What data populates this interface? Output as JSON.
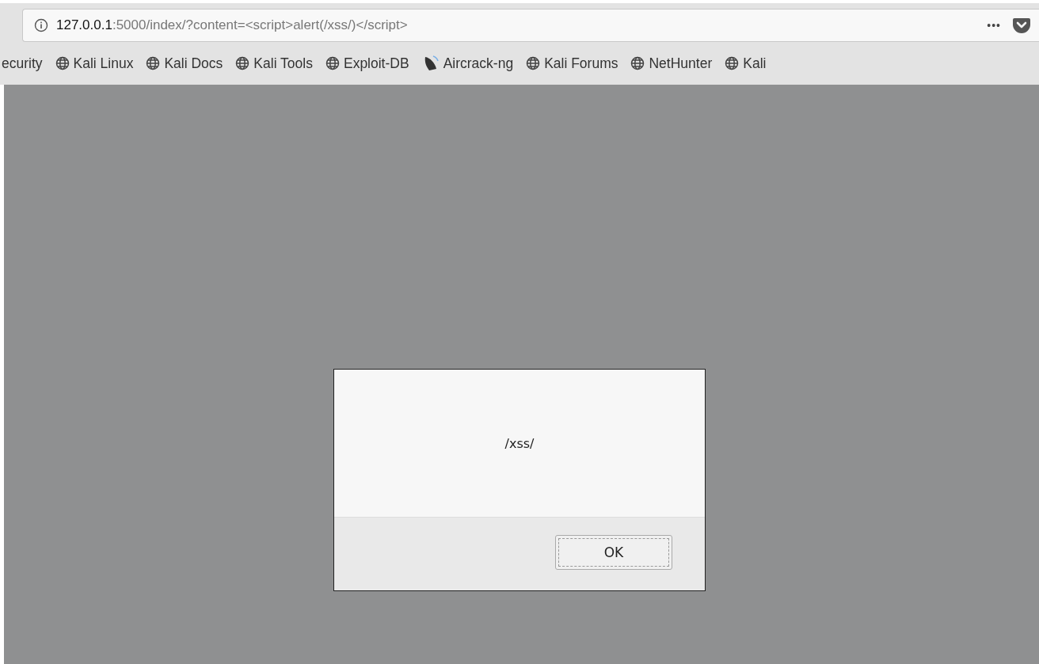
{
  "address_bar": {
    "host": "127.0.0.1",
    "rest": ":5000/index/?content=<script>alert(/xss/)</script>",
    "menu": "•••"
  },
  "bookmarks": [
    {
      "label": "ecurity",
      "kind": "none"
    },
    {
      "label": "Kali Linux",
      "kind": "globe"
    },
    {
      "label": "Kali Docs",
      "kind": "globe"
    },
    {
      "label": "Kali Tools",
      "kind": "globe"
    },
    {
      "label": "Exploit-DB",
      "kind": "globe"
    },
    {
      "label": "Aircrack-ng",
      "kind": "dish"
    },
    {
      "label": "Kali Forums",
      "kind": "globe"
    },
    {
      "label": "NetHunter",
      "kind": "globe"
    },
    {
      "label": "Kali",
      "kind": "globe"
    }
  ],
  "alert": {
    "message": "/xss/",
    "button": "OK"
  }
}
